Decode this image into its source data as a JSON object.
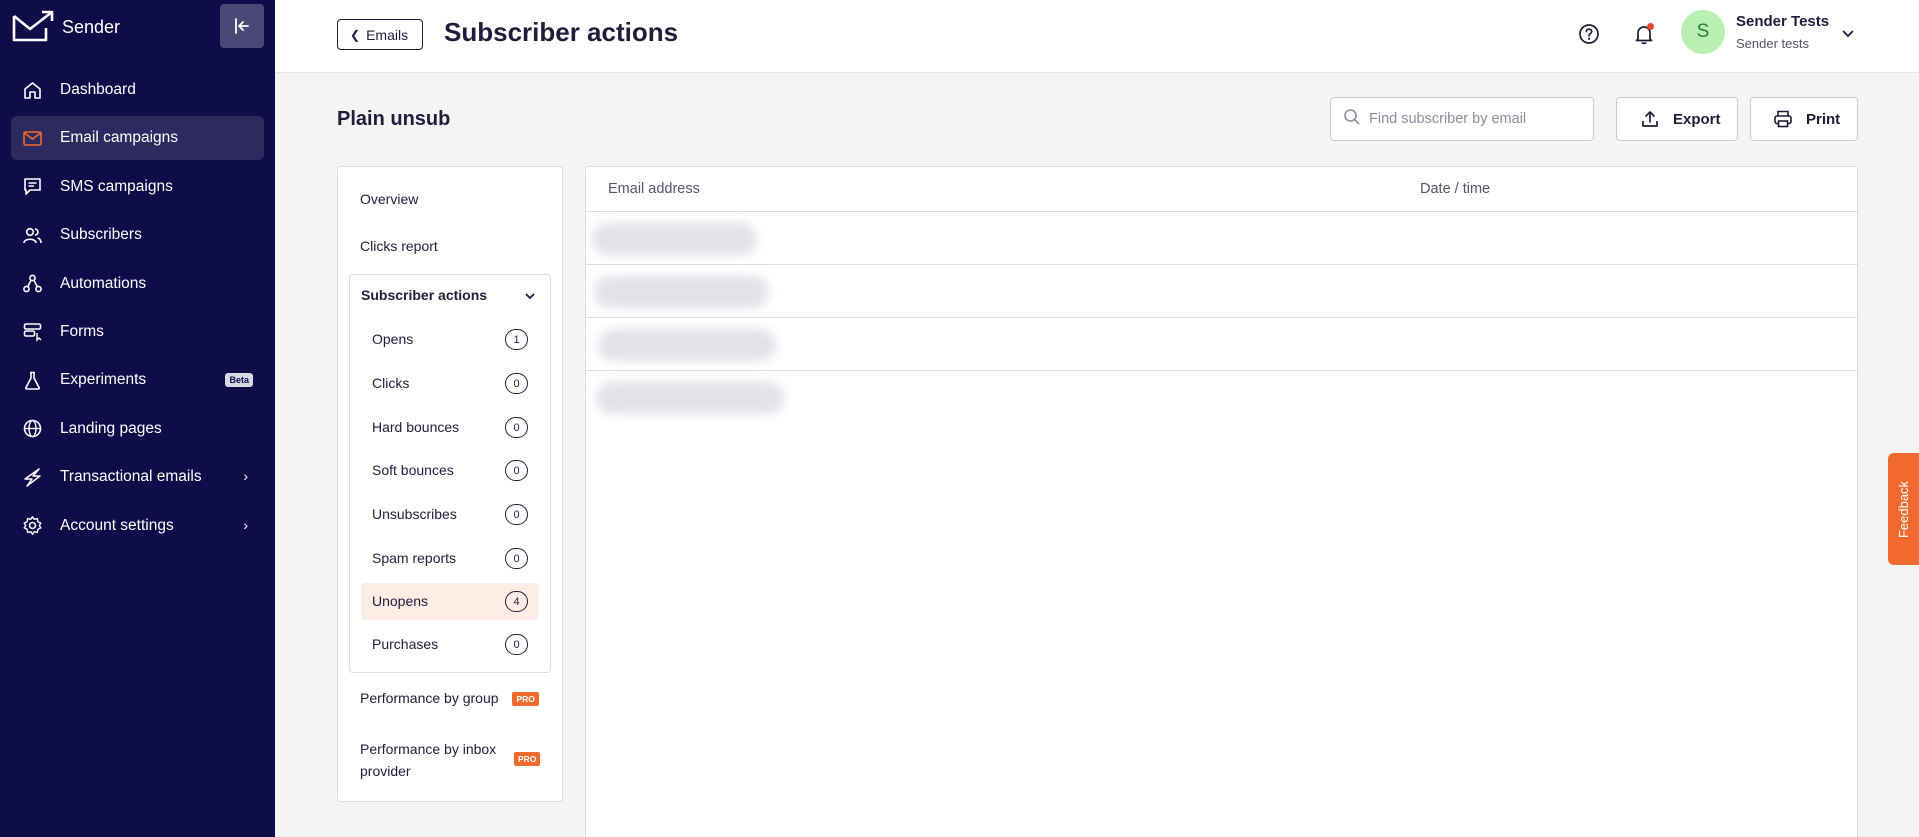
{
  "app": {
    "brand": "Sender"
  },
  "sidebar": {
    "items": [
      {
        "label": "Dashboard",
        "icon": "home-icon"
      },
      {
        "label": "Email campaigns",
        "icon": "mail-icon",
        "active": true
      },
      {
        "label": "SMS campaigns",
        "icon": "chat-icon"
      },
      {
        "label": "Subscribers",
        "icon": "users-icon"
      },
      {
        "label": "Automations",
        "icon": "automation-icon"
      },
      {
        "label": "Forms",
        "icon": "forms-icon"
      },
      {
        "label": "Experiments",
        "icon": "flask-icon",
        "badge": "Beta"
      },
      {
        "label": "Landing pages",
        "icon": "globe-icon"
      },
      {
        "label": "Transactional emails",
        "icon": "bolt-icon",
        "has_submenu": true
      },
      {
        "label": "Account settings",
        "icon": "gear-icon",
        "has_submenu": true
      }
    ]
  },
  "header": {
    "back_label": "Emails",
    "title": "Subscriber actions",
    "user": {
      "initial": "S",
      "name": "Sender Tests",
      "subtitle": "Sender tests"
    }
  },
  "main": {
    "campaign_name": "Plain unsub",
    "search": {
      "placeholder": "Find subscriber by email",
      "value": ""
    },
    "export_label": "Export",
    "print_label": "Print"
  },
  "report_menu": {
    "overview": "Overview",
    "clicks_report": "Clicks report",
    "subscriber_actions": {
      "label": "Subscriber actions",
      "items": [
        {
          "label": "Opens",
          "count": "1"
        },
        {
          "label": "Clicks",
          "count": "0"
        },
        {
          "label": "Hard bounces",
          "count": "0"
        },
        {
          "label": "Soft bounces",
          "count": "0"
        },
        {
          "label": "Unsubscribes",
          "count": "0"
        },
        {
          "label": "Spam reports",
          "count": "0"
        },
        {
          "label": "Unopens",
          "count": "4",
          "active": true
        },
        {
          "label": "Purchases",
          "count": "0"
        }
      ]
    },
    "performance_by_group": "Performance by group",
    "performance_by_inbox": "Performance by inbox provider",
    "pro_badge": "PRO"
  },
  "table": {
    "columns": [
      "Email address",
      "Date / time"
    ],
    "rows": [
      {
        "email": "",
        "datetime": ""
      },
      {
        "email": "",
        "datetime": ""
      },
      {
        "email": "",
        "datetime": ""
      },
      {
        "email": "",
        "datetime": ""
      }
    ]
  },
  "feedback_label": "Feedback",
  "colors": {
    "sidebar_bg": "#0f0c4a",
    "accent_orange": "#f06a2f",
    "active_row": "#fdeee5",
    "avatar_bg": "#b7f0b1"
  }
}
